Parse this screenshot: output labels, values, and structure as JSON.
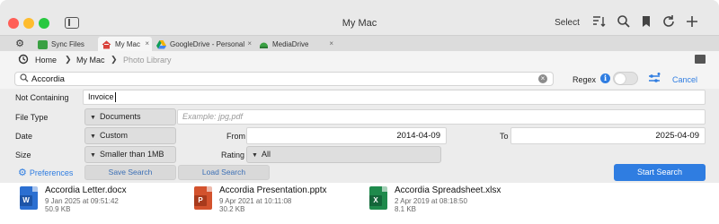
{
  "window": {
    "title": "My Mac",
    "select_label": "Select"
  },
  "toolbar_icons": [
    "sort-icon",
    "search-icon",
    "bookmark-icon",
    "refresh-icon",
    "plus-icon"
  ],
  "tabs": [
    {
      "label": "Sync Files",
      "icon": "sync-icon",
      "color": "#3aa043"
    },
    {
      "label": "My Mac",
      "icon": "home-icon",
      "color": "#d9413a"
    },
    {
      "label": "GoogleDrive - Personal",
      "icon": "google-drive-icon",
      "color": "#f4b400"
    },
    {
      "label": "MediaDrive",
      "icon": "drive-icon",
      "color": "#3aa043"
    }
  ],
  "breadcrumb": {
    "items": [
      "Home",
      "My Mac",
      "Photo Library"
    ],
    "separator": "❯"
  },
  "search": {
    "value": "Accordia",
    "regex_label": "Regex",
    "cancel_label": "Cancel",
    "regex_enabled": false
  },
  "filters": {
    "not_containing": {
      "label": "Not Containing",
      "value": "Invoice"
    },
    "file_type": {
      "label": "File Type",
      "selected": "Documents",
      "placeholder": "Example: jpg,pdf"
    },
    "date": {
      "label": "Date",
      "selected": "Custom",
      "from_label": "From",
      "from_value": "2014-04-09",
      "to_label": "To",
      "to_value": "2025-04-09"
    },
    "size": {
      "label": "Size",
      "selected": "Smaller than 1MB",
      "rating_label": "Rating",
      "rating_selected": "All"
    }
  },
  "actions": {
    "preferences": "Preferences",
    "save_search": "Save Search",
    "load_search": "Load Search",
    "start_search": "Start Search"
  },
  "results": [
    {
      "name": "Accordia Letter.docx",
      "date": "9 Jan 2025 at 09:51:42",
      "size": "50.9 KB",
      "icon": "word-doc-icon",
      "color": "#2b6fd1",
      "letter": "W"
    },
    {
      "name": "Accordia Presentation.pptx",
      "date": "9 Apr 2021 at 10:11:08",
      "size": "30.2 KB",
      "icon": "powerpoint-doc-icon",
      "color": "#d3522d",
      "letter": "P"
    },
    {
      "name": "Accordia Spreadsheet.xlsx",
      "date": "2 Apr 2019 at 08:18:50",
      "size": "8.1 KB",
      "icon": "excel-doc-icon",
      "color": "#1f8a4c",
      "letter": "X"
    }
  ],
  "colors": {
    "accent": "#2f7de1",
    "window_bg": "#ececec"
  }
}
